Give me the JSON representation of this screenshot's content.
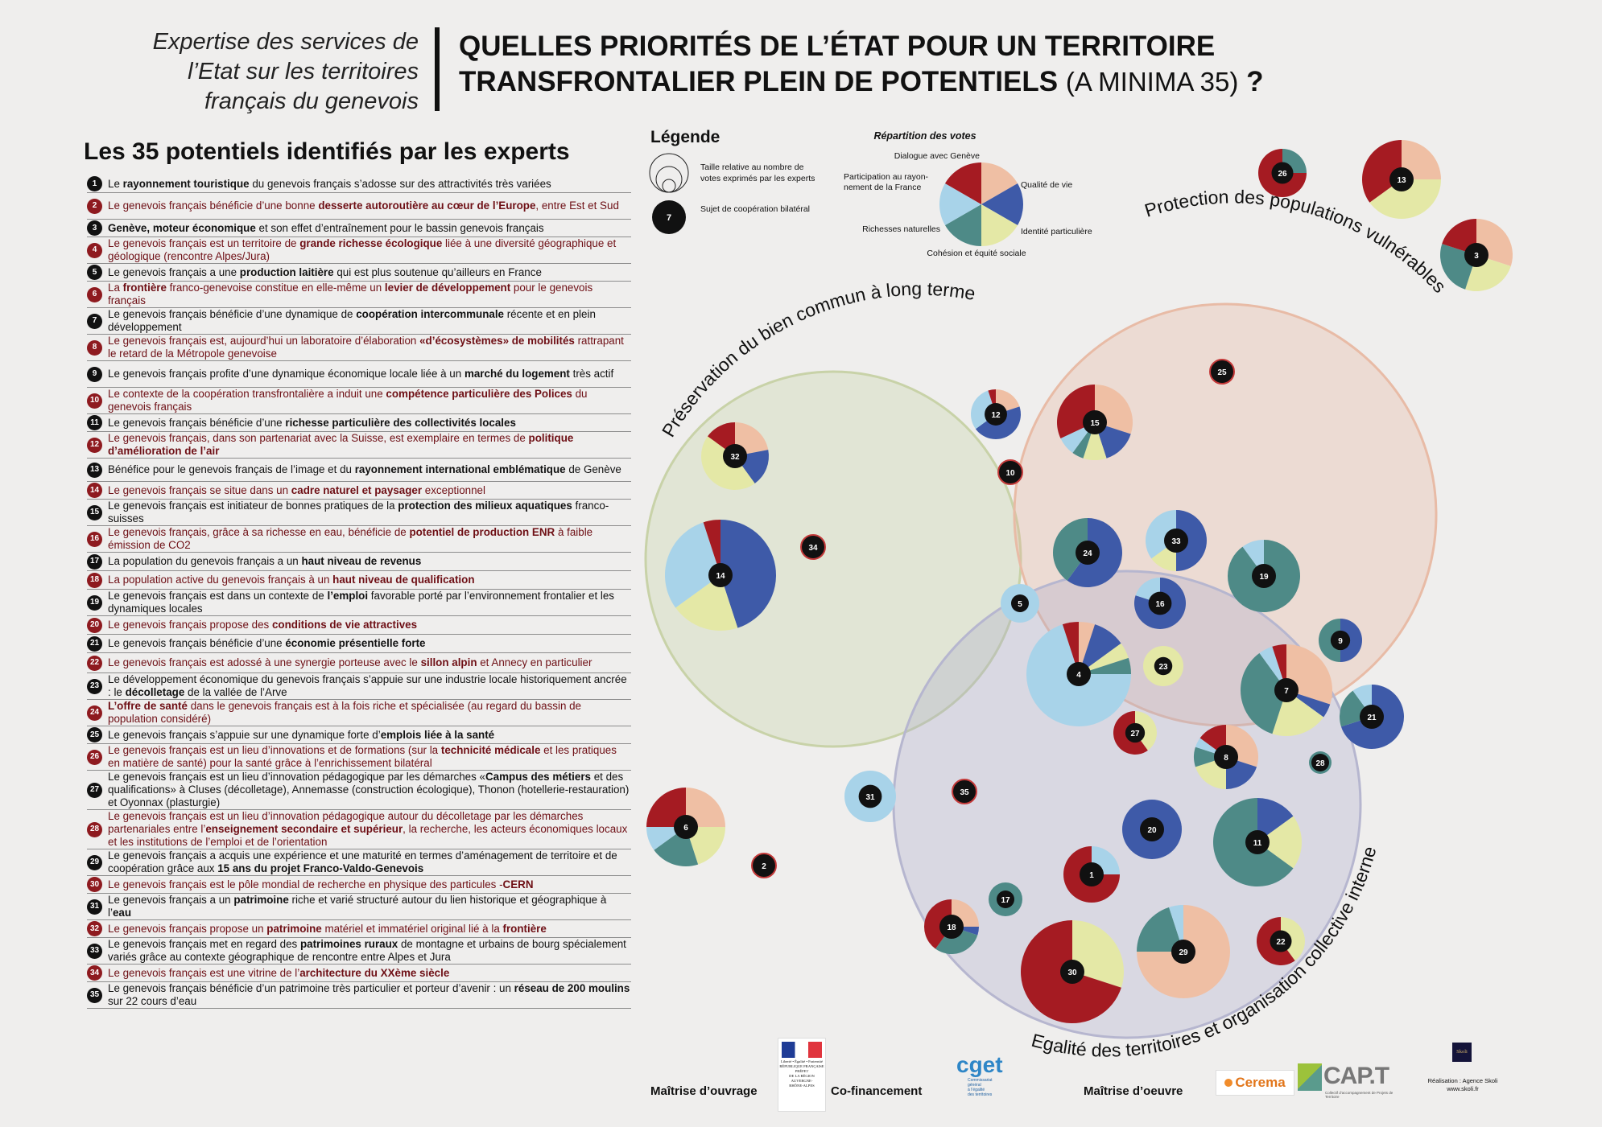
{
  "header": {
    "left_lines": [
      "Expertise des services de",
      "l’Etat sur les territoires",
      "français du genevois"
    ],
    "title_line1": "QUELLES PRIORITÉS DE L’ÉTAT POUR UN TERRITOIRE",
    "title_line2": "TRANSFRONTALIER PLEIN DE POTENTIELS",
    "title_suffix": "(A MINIMA 35)",
    "title_q": "?"
  },
  "list_title": "Les 35 potentiels identifiés par les experts",
  "items": [
    {
      "n": "1",
      "parts": [
        [
          "Le ",
          0
        ],
        [
          "rayonnement touristique",
          1
        ],
        [
          " du genevois français s’adosse sur des attractivités très variées",
          0
        ]
      ]
    },
    {
      "n": "2",
      "parts": [
        [
          "Le genevois français bénéficie d’une bonne ",
          0
        ],
        [
          "desserte autoroutière au cœur de l’Europe",
          1
        ],
        [
          ", entre Est et Sud",
          0
        ]
      ]
    },
    {
      "n": "3",
      "parts": [
        [
          "Genève, moteur économique",
          1
        ],
        [
          " et son effet d’entraînement pour le bassin genevois français",
          0
        ]
      ]
    },
    {
      "n": "4",
      "parts": [
        [
          "Le genevois français est un territoire de ",
          0
        ],
        [
          "grande richesse écologique",
          1
        ],
        [
          " liée à une diversité géographique et géologique (rencontre Alpes/Jura)",
          0
        ]
      ]
    },
    {
      "n": "5",
      "parts": [
        [
          "Le genevois français a une ",
          0
        ],
        [
          "production laitière",
          1
        ],
        [
          " qui est plus soutenue qu’ailleurs en France",
          0
        ]
      ]
    },
    {
      "n": "6",
      "parts": [
        [
          "La ",
          0
        ],
        [
          "frontière",
          1
        ],
        [
          " franco-genevoise constitue en elle-même un ",
          0
        ],
        [
          "levier de développement",
          1
        ],
        [
          " pour le genevois français",
          0
        ]
      ]
    },
    {
      "n": "7",
      "parts": [
        [
          "Le genevois français bénéficie d’une dynamique de ",
          0
        ],
        [
          "coopération intercommunale",
          1
        ],
        [
          " récente et en plein développement",
          0
        ]
      ]
    },
    {
      "n": "8",
      "parts": [
        [
          "Le genevois français est, aujourd’hui un laboratoire d’élaboration ",
          0
        ],
        [
          "«d’écosystèmes» de mobilités",
          1
        ],
        [
          " rattrapant le retard de la Métropole genevoise",
          0
        ]
      ]
    },
    {
      "n": "9",
      "parts": [
        [
          "Le genevois français profite d’une dynamique économique locale liée à un ",
          0
        ],
        [
          "marché du logement",
          1
        ],
        [
          " très actif",
          0
        ]
      ]
    },
    {
      "n": "10",
      "parts": [
        [
          "Le contexte de la coopération transfrontalière a induit une ",
          0
        ],
        [
          "compétence particulière des Polices",
          1
        ],
        [
          " du genevois français",
          0
        ]
      ]
    },
    {
      "n": "11",
      "parts": [
        [
          "Le genevois français bénéficie d’une ",
          0
        ],
        [
          "richesse particulière des collectivités locales",
          1
        ]
      ]
    },
    {
      "n": "12",
      "parts": [
        [
          "Le genevois français, dans son partenariat avec la Suisse, est exemplaire en termes de ",
          0
        ],
        [
          "politique d’amélioration de l’air",
          1
        ]
      ]
    },
    {
      "n": "13",
      "parts": [
        [
          "Bénéfice pour le genevois français de l’image et du ",
          0
        ],
        [
          "rayonnement international emblématique",
          1
        ],
        [
          " de Genève",
          0
        ]
      ]
    },
    {
      "n": "14",
      "parts": [
        [
          "Le genevois français se situe dans un ",
          0
        ],
        [
          "cadre naturel et paysager",
          1
        ],
        [
          " exceptionnel",
          0
        ]
      ]
    },
    {
      "n": "15",
      "parts": [
        [
          "Le genevois français est initiateur de bonnes pratiques de la ",
          0
        ],
        [
          "protection des milieux aquatiques",
          1
        ],
        [
          " franco-suisses",
          0
        ]
      ]
    },
    {
      "n": "16",
      "parts": [
        [
          "Le genevois français, grâce à sa richesse en eau, bénéficie de ",
          0
        ],
        [
          "potentiel de production ENR",
          1
        ],
        [
          " à faible émission de CO2",
          0
        ]
      ]
    },
    {
      "n": "17",
      "parts": [
        [
          "La population du genevois français a un ",
          0
        ],
        [
          "haut niveau de revenus",
          1
        ]
      ]
    },
    {
      "n": "18",
      "parts": [
        [
          "La population active du genevois français à un ",
          0
        ],
        [
          "haut niveau de qualification",
          1
        ]
      ]
    },
    {
      "n": "19",
      "parts": [
        [
          "Le genevois français est dans un contexte de ",
          0
        ],
        [
          "l’emploi",
          1
        ],
        [
          " favorable porté par l’environnement frontalier et les dynamiques locales",
          0
        ]
      ]
    },
    {
      "n": "20",
      "parts": [
        [
          "Le genevois français propose des ",
          0
        ],
        [
          "conditions de vie attractives",
          1
        ]
      ]
    },
    {
      "n": "21",
      "parts": [
        [
          "Le genevois français bénéficie d’une ",
          0
        ],
        [
          "économie présentielle forte",
          1
        ]
      ]
    },
    {
      "n": "22",
      "parts": [
        [
          "Le genevois français est adossé à une synergie porteuse avec le ",
          0
        ],
        [
          "sillon alpin",
          1
        ],
        [
          " et Annecy en particulier",
          0
        ]
      ]
    },
    {
      "n": "23",
      "parts": [
        [
          "Le développement économique du genevois français s’appuie sur une industrie locale historiquement ancrée : le ",
          0
        ],
        [
          "décolletage",
          1
        ],
        [
          " de la vallée de l’Arve",
          0
        ]
      ]
    },
    {
      "n": "24",
      "parts": [
        [
          "L’offre de santé",
          1
        ],
        [
          " dans le genevois français est à la fois riche et spécialisée (au regard du bassin de population considéré)",
          0
        ]
      ]
    },
    {
      "n": "25",
      "parts": [
        [
          "Le genevois français s’appuie sur une dynamique forte d’",
          0
        ],
        [
          "emplois liée à la santé",
          1
        ]
      ]
    },
    {
      "n": "26",
      "parts": [
        [
          "Le genevois français est un lieu d’innovations et de formations (sur la ",
          0
        ],
        [
          "technicité médicale",
          1
        ],
        [
          " et les pratiques en matière de santé) pour la santé grâce à l’enrichissement bilatéral",
          0
        ]
      ]
    },
    {
      "n": "27",
      "parts": [
        [
          "Le genevois français est un lieu d’innovation pédagogique par les démarches «",
          0
        ],
        [
          "Campus des métiers",
          1
        ],
        [
          " et des qualifications» à Cluses (décolletage), Annemasse (construction écologique), Thonon (hotellerie-restauration) et Oyonnax (plasturgie)",
          0
        ]
      ]
    },
    {
      "n": "28",
      "parts": [
        [
          "Le genevois français est un lieu d’innovation pédagogique autour du décolletage par les démarches partenariales entre l’",
          0
        ],
        [
          "enseignement secondaire et supérieur",
          1
        ],
        [
          ", la recherche, les acteurs économiques locaux et les institutions de l’emploi et de l’orientation",
          0
        ]
      ]
    },
    {
      "n": "29",
      "parts": [
        [
          "Le genevois français a acquis une expérience et une maturité en termes d’aménagement de territoire et de coopération grâce aux ",
          0
        ],
        [
          "15 ans du projet Franco-Valdo-Genevois",
          1
        ]
      ]
    },
    {
      "n": "30",
      "parts": [
        [
          "Le genevois français est le pôle mondial de recherche en physique des particules -",
          0
        ],
        [
          "CERN",
          1
        ]
      ]
    },
    {
      "n": "31",
      "parts": [
        [
          "Le genevois français a un ",
          0
        ],
        [
          "patrimoine",
          1
        ],
        [
          " riche et varié structuré autour du lien historique et géographique à l’",
          0
        ],
        [
          "eau",
          1
        ]
      ]
    },
    {
      "n": "32",
      "parts": [
        [
          "Le genevois français propose un ",
          0
        ],
        [
          "patrimoine",
          1
        ],
        [
          " matériel et immatériel original lié à la ",
          0
        ],
        [
          "frontière",
          1
        ]
      ]
    },
    {
      "n": "33",
      "parts": [
        [
          "Le genevois français met en regard des ",
          0
        ],
        [
          "patrimoines ruraux",
          1
        ],
        [
          " de montagne et urbains de bourg spécialement variés grâce au contexte géographique de rencontre entre Alpes et Jura",
          0
        ]
      ]
    },
    {
      "n": "34",
      "parts": [
        [
          "Le genevois français est une vitrine de l’",
          0
        ],
        [
          "architecture du XXème siècle",
          1
        ]
      ]
    },
    {
      "n": "35",
      "parts": [
        [
          "Le genevois français bénéficie d’un patrimoine très particulier et porteur d’avenir : un ",
          0
        ],
        [
          "réseau de 200 moulins",
          1
        ],
        [
          " sur 22 cours d’eau",
          0
        ]
      ]
    }
  ],
  "legend": {
    "title": "Légende",
    "size_text": [
      "Taille relative au nombre de",
      "votes exprimés par les experts"
    ],
    "bilateral_text": "Sujet de coopération bilatéral",
    "bilateral_sample": "7",
    "votes_title": "Répartition des votes",
    "categories": [
      {
        "label": "Dialogue avec Genève",
        "color": "#efbfa4"
      },
      {
        "label": "Qualité de vie",
        "color": "#3e5aa8"
      },
      {
        "label": "Identité particulière",
        "color": "#e4e8a6"
      },
      {
        "label": "Cohésion et équité sociale",
        "color": "#4e8a87"
      },
      {
        "label": "Richesses naturelles",
        "color": "#a8d3e9"
      },
      {
        "label": "Participation au rayon-\nnement de la France",
        "color": "#a51b22"
      }
    ]
  },
  "circles": {
    "preservation": {
      "label": "Préservation du bien commun à long terme",
      "color": "#c5d3a2"
    },
    "protection": {
      "label": "Protection des populations vulnérables",
      "color": "#e7b59c"
    },
    "egalite": {
      "label": "Egalité des territoires et organisation collective interne",
      "color": "#aaaac9"
    }
  },
  "pies": [
    {
      "id": "26",
      "shares": [
        0,
        0,
        0,
        0.25,
        0,
        0.75
      ],
      "bilateral": false
    },
    {
      "id": "13",
      "shares": [
        0.25,
        0,
        0.4,
        0,
        0,
        0.35
      ],
      "bilateral": false
    },
    {
      "id": "3",
      "shares": [
        0.3,
        0,
        0.25,
        0.25,
        0,
        0.2
      ],
      "bilateral": false
    },
    {
      "id": "25",
      "shares": [
        0,
        0,
        0,
        0,
        0,
        0
      ],
      "bilateral": true
    },
    {
      "id": "12",
      "shares": [
        0.2,
        0.45,
        0,
        0,
        0.3,
        0.05
      ],
      "bilateral": false
    },
    {
      "id": "15",
      "shares": [
        0.3,
        0.15,
        0.1,
        0.05,
        0.08,
        0.32
      ],
      "bilateral": false
    },
    {
      "id": "10",
      "shares": [
        0,
        0,
        0,
        0,
        0,
        0
      ],
      "bilateral": true
    },
    {
      "id": "32",
      "shares": [
        0.22,
        0.18,
        0.45,
        0,
        0,
        0.15
      ],
      "bilateral": false
    },
    {
      "id": "14",
      "shares": [
        0,
        0.45,
        0.2,
        0,
        0.3,
        0.05
      ],
      "bilateral": false
    },
    {
      "id": "34",
      "shares": [
        0,
        0,
        0,
        0,
        0,
        0
      ],
      "bilateral": true
    },
    {
      "id": "24",
      "shares": [
        0,
        0.6,
        0,
        0.4,
        0,
        0
      ],
      "bilateral": false
    },
    {
      "id": "33",
      "shares": [
        0,
        0.5,
        0.15,
        0,
        0.35,
        0
      ],
      "bilateral": false
    },
    {
      "id": "19",
      "shares": [
        0,
        0,
        0,
        0.9,
        0.1,
        0
      ],
      "bilateral": false
    },
    {
      "id": "5",
      "shares": [
        0,
        0,
        0,
        0,
        1,
        0
      ],
      "bilateral": false
    },
    {
      "id": "16",
      "shares": [
        0,
        0.8,
        0,
        0,
        0.2,
        0
      ],
      "bilateral": false
    },
    {
      "id": "9",
      "shares": [
        0,
        0.5,
        0,
        0.5,
        0,
        0
      ],
      "bilateral": false
    },
    {
      "id": "4",
      "shares": [
        0.05,
        0.1,
        0.05,
        0.05,
        0.7,
        0.05
      ],
      "bilateral": false
    },
    {
      "id": "23",
      "shares": [
        0,
        0,
        1,
        0,
        0,
        0
      ],
      "bilateral": false
    },
    {
      "id": "7",
      "shares": [
        0.3,
        0.05,
        0.2,
        0.35,
        0.05,
        0.05
      ],
      "bilateral": false
    },
    {
      "id": "21",
      "shares": [
        0,
        0.7,
        0,
        0.2,
        0.1,
        0
      ],
      "bilateral": false
    },
    {
      "id": "27",
      "shares": [
        0,
        0,
        0.4,
        0,
        0,
        0.6
      ],
      "bilateral": false
    },
    {
      "id": "8",
      "shares": [
        0.3,
        0.2,
        0.2,
        0.1,
        0.05,
        0.15
      ],
      "bilateral": false
    },
    {
      "id": "28",
      "shares": [
        0,
        0,
        0,
        1,
        0,
        0
      ],
      "bilateral": false
    },
    {
      "id": "31",
      "shares": [
        0,
        0,
        0,
        0,
        1,
        0
      ],
      "bilateral": false
    },
    {
      "id": "35",
      "shares": [
        0,
        0,
        0,
        0,
        0,
        0
      ],
      "bilateral": true
    },
    {
      "id": "20",
      "shares": [
        0,
        1,
        0,
        0,
        0,
        0
      ],
      "bilateral": false
    },
    {
      "id": "11",
      "shares": [
        0,
        0.15,
        0.2,
        0.65,
        0,
        0
      ],
      "bilateral": false
    },
    {
      "id": "6",
      "shares": [
        0.25,
        0,
        0.2,
        0.2,
        0.1,
        0.25
      ],
      "bilateral": false
    },
    {
      "id": "2",
      "shares": [
        0,
        0,
        0,
        0,
        0,
        0
      ],
      "bilateral": true
    },
    {
      "id": "1",
      "shares": [
        0,
        0,
        0,
        0,
        0.25,
        0.75
      ],
      "bilateral": false
    },
    {
      "id": "17",
      "shares": [
        0,
        0,
        0,
        1,
        0,
        0
      ],
      "bilateral": false
    },
    {
      "id": "18",
      "shares": [
        0.25,
        0.05,
        0,
        0.3,
        0,
        0.4
      ],
      "bilateral": false
    },
    {
      "id": "30",
      "shares": [
        0,
        0,
        0.3,
        0,
        0,
        0.7
      ],
      "bilateral": false
    },
    {
      "id": "29",
      "shares": [
        0.75,
        0,
        0,
        0.2,
        0.05,
        0
      ],
      "bilateral": false
    },
    {
      "id": "22",
      "shares": [
        0,
        0,
        0.4,
        0,
        0,
        0.6
      ],
      "bilateral": false
    }
  ],
  "footer": {
    "maitrise_ouvrage": "Maîtrise d’ouvrage",
    "cofinancement": "Co-financement",
    "maitrise_oeuvre": "Maîtrise d’oeuvre",
    "prefet_lines": [
      "Liberté • Égalité • Fraternité",
      "RÉPUBLIQUE FRANÇAISE",
      "PRÉFET",
      "DE LA RÉGION",
      "AUVERGNE-",
      "RHÔNE-ALPES"
    ],
    "cget": "cget",
    "cget_lines": [
      "Commissariat",
      "général",
      "à l’égalité",
      "des territoires"
    ],
    "cerema": "Cerema",
    "capt": "CAP.T",
    "capt_sub": "Collectif d’accompagnement de Projets de Territoire",
    "skoli": "Skoli",
    "realisation": "Réalisation : Agence Skoli",
    "skoli_url": "www.skoli.fr"
  }
}
